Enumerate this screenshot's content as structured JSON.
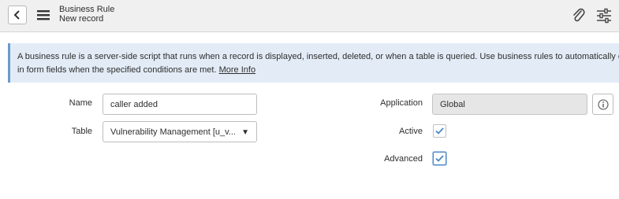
{
  "header": {
    "title": "Business Rule",
    "subtitle": "New record",
    "back_icon": "chevron-left-icon",
    "menu_icon": "hamburger-icon",
    "attach_icon": "paperclip-icon",
    "settings_icon": "sliders-icon"
  },
  "info": {
    "text": "A business rule is a server-side script that runs when a record is displayed, inserted, deleted, or when a table is queried. Use business rules to automatically chan",
    "text2": "in form fields when the specified conditions are met.",
    "link": "More Info"
  },
  "form": {
    "name_label": "Name",
    "name_value": "caller added",
    "table_label": "Table",
    "table_value": "Vulnerability Management [u_v...",
    "application_label": "Application",
    "application_value": "Global",
    "active_label": "Active",
    "active_checked": true,
    "advanced_label": "Advanced",
    "advanced_checked": true
  },
  "colors": {
    "accent": "#4b86c4",
    "info_bg": "#e3ecf6"
  }
}
